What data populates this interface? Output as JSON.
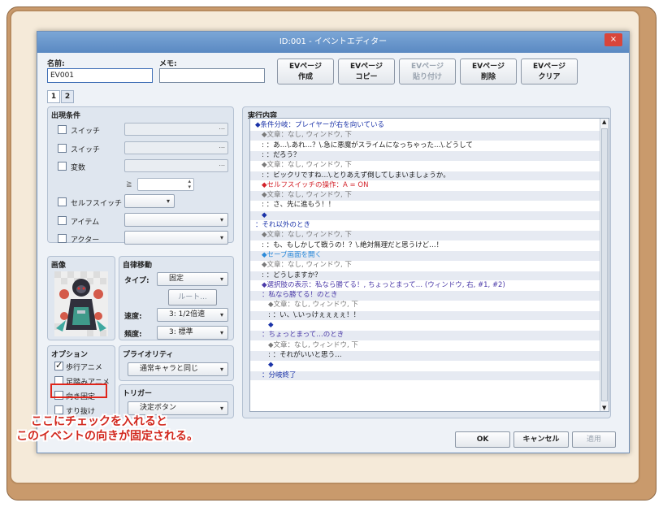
{
  "window": {
    "title": "ID:001 - イベントエディター",
    "close": "×"
  },
  "header": {
    "name_label": "名前:",
    "name_value": "EV001",
    "memo_label": "メモ:",
    "memo_value": ""
  },
  "toolbar": [
    {
      "line1": "EVページ",
      "line2": "作成",
      "disabled": false
    },
    {
      "line1": "EVページ",
      "line2": "コピー",
      "disabled": false
    },
    {
      "line1": "EVページ",
      "line2": "貼り付け",
      "disabled": true
    },
    {
      "line1": "EVページ",
      "line2": "削除",
      "disabled": false
    },
    {
      "line1": "EVページ",
      "line2": "クリア",
      "disabled": false
    }
  ],
  "tabs": [
    "1",
    "2"
  ],
  "conditions": {
    "title": "出現条件",
    "switch1": "スイッチ",
    "switch2": "スイッチ",
    "variable": "変数",
    "ge": "≧",
    "self_switch": "セルフスイッチ",
    "item": "アイテム",
    "actor": "アクター",
    "ellipsis": "..."
  },
  "image": {
    "title": "画像"
  },
  "autonomous": {
    "title": "自律移動",
    "type_label": "タイプ:",
    "type_value": "固定",
    "route_button": "ルート...",
    "speed_label": "速度:",
    "speed_value": "3: 1/2倍速",
    "freq_label": "頻度:",
    "freq_value": "3: 標準"
  },
  "options": {
    "title": "オプション",
    "walking": "歩行アニメ",
    "stepping": "足踏みアニメ",
    "direction_fix": "向き固定",
    "through": "すり抜け"
  },
  "priority": {
    "title": "プライオリティ",
    "value": "通常キャラと同じ"
  },
  "trigger": {
    "title": "トリガー",
    "value": "決定ボタン"
  },
  "contents": {
    "title": "実行内容"
  },
  "lines": [
    {
      "t": "◆条件分岐：プレイヤーが右を向いている",
      "c": "blue",
      "i": 0
    },
    {
      "t": "◆文章：なし, ウィンドウ, 下",
      "c": "gray",
      "i": 1
    },
    {
      "t": ":        ：あ…\\.あれ…？\\.急に悪魔がスライムになっちゃった…\\.どうして",
      "c": "dark",
      "i": 1
    },
    {
      "t": ":        ：だろう？",
      "c": "dark",
      "i": 1
    },
    {
      "t": "◆文章：なし, ウィンドウ, 下",
      "c": "gray",
      "i": 1
    },
    {
      "t": ":        ：ビックリですね…\\.とりあえず倒してしまいましょうか。",
      "c": "dark",
      "i": 1
    },
    {
      "t": "◆セルフスイッチの操作：A = ON",
      "c": "red",
      "i": 1
    },
    {
      "t": "◆文章：なし, ウィンドウ, 下",
      "c": "gray",
      "i": 1
    },
    {
      "t": ":        ：さ、先に進もう！！",
      "c": "dark",
      "i": 1
    },
    {
      "t": "◆",
      "c": "dia",
      "i": 1
    },
    {
      "t": "：それ以外のとき",
      "c": "blue",
      "i": 0
    },
    {
      "t": "◆文章：なし, ウィンドウ, 下",
      "c": "gray",
      "i": 1
    },
    {
      "t": ":        ：も、もしかして戦うの！？\\.絶対無理だと思うけど…！",
      "c": "dark",
      "i": 1
    },
    {
      "t": "◆セーブ画面を開く",
      "c": "cyan",
      "i": 1
    },
    {
      "t": "◆文章：なし, ウィンドウ, 下",
      "c": "gray",
      "i": 1
    },
    {
      "t": ":        ：どうしますか？",
      "c": "dark",
      "i": 1
    },
    {
      "t": "◆選択肢の表示：私なら勝てる！, ちょっとまって… (ウィンドウ, 右, #1, #2)",
      "c": "purple",
      "i": 1
    },
    {
      "t": "：私なら勝てる！のとき",
      "c": "purple",
      "i": 1
    },
    {
      "t": "◆文章：なし, ウィンドウ, 下",
      "c": "gray",
      "i": 2
    },
    {
      "t": ":        ：い、\\.いっけぇぇぇぇ！！",
      "c": "dark",
      "i": 2
    },
    {
      "t": "◆",
      "c": "dia",
      "i": 2
    },
    {
      "t": "：ちょっとまって…のとき",
      "c": "purple",
      "i": 1
    },
    {
      "t": "◆文章：なし, ウィンドウ, 下",
      "c": "gray",
      "i": 2
    },
    {
      "t": ":        ：それがいいと思う…",
      "c": "dark",
      "i": 2
    },
    {
      "t": "◆",
      "c": "dia",
      "i": 2
    },
    {
      "t": "：分岐終了",
      "c": "blue",
      "i": 1
    }
  ],
  "buttons": {
    "ok": "OK",
    "cancel": "キャンセル",
    "apply": "適用"
  },
  "callout": {
    "line1": "ここにチェックを入れると",
    "line2": "このイベントの向きが固定される。"
  }
}
